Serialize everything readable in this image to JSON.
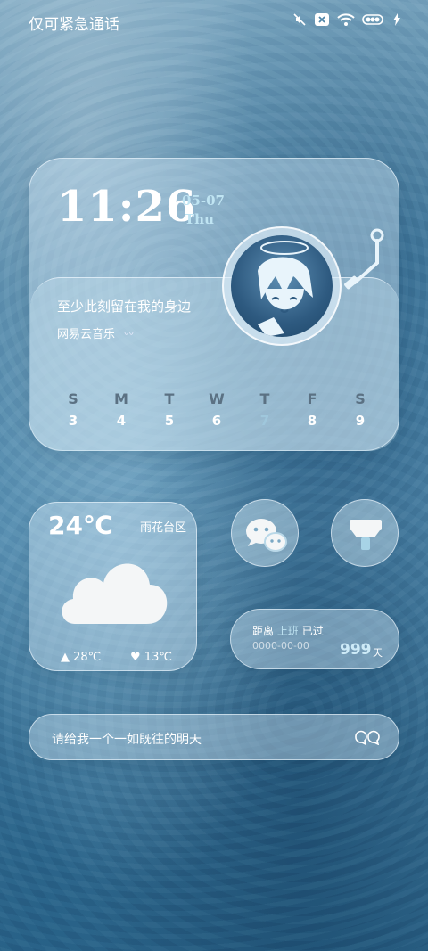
{
  "status_bar": {
    "carrier": "仅可紧急通话",
    "icons": [
      "mute-vibrate-icon",
      "no-sim-icon",
      "wifi-icon",
      "battery-icon",
      "charging-icon"
    ]
  },
  "music_widget": {
    "time": "11:26",
    "date": "05-07",
    "weekday": "Thu",
    "song": "至少此刻留在我的身边",
    "app": "网易云音乐",
    "week": [
      {
        "day": "S",
        "num": "3"
      },
      {
        "day": "M",
        "num": "4"
      },
      {
        "day": "T",
        "num": "5"
      },
      {
        "day": "W",
        "num": "6"
      },
      {
        "day": "T",
        "num": "7"
      },
      {
        "day": "F",
        "num": "8"
      },
      {
        "day": "S",
        "num": "9"
      }
    ],
    "today_index": 4
  },
  "weather_widget": {
    "temperature": "24℃",
    "city": "雨花台区",
    "high": "28℃",
    "low": "13℃",
    "condition_icon": "cloud-icon"
  },
  "shortcuts": [
    {
      "name": "wechat",
      "icon": "chat-bubble-icon"
    },
    {
      "name": "cleaner",
      "icon": "broom-icon"
    }
  ],
  "countdown_widget": {
    "label_prefix": "距离",
    "label_event": "上班",
    "label_suffix": "已过",
    "date": "0000-00-00",
    "days": "999",
    "unit": "天"
  },
  "quote_widget": {
    "text": "请给我一个一如既往的明天"
  },
  "colors": {
    "accent": "#bfe4f2",
    "glass": "#d2e8f5",
    "background": "#4f86a8"
  }
}
